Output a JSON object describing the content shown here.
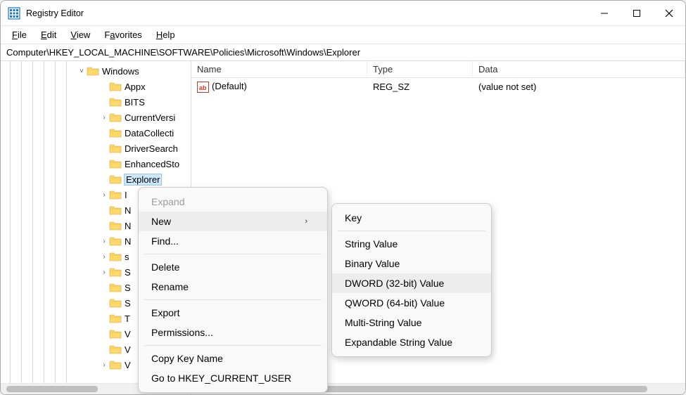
{
  "window": {
    "title": "Registry Editor"
  },
  "menubar": {
    "file": "File",
    "edit": "Edit",
    "view": "View",
    "favorites": "Favorites",
    "help": "Help"
  },
  "address": "Computer\\HKEY_LOCAL_MACHINE\\SOFTWARE\\Policies\\Microsoft\\Windows\\Explorer",
  "tree": {
    "root_indent": 108,
    "items": [
      {
        "label": "Windows",
        "expander": "˅",
        "indent": 108,
        "selected": false
      },
      {
        "label": "Appx",
        "expander": "",
        "indent": 140,
        "selected": false
      },
      {
        "label": "BITS",
        "expander": "",
        "indent": 140,
        "selected": false
      },
      {
        "label": "CurrentVersi",
        "expander": "›",
        "indent": 140,
        "selected": false
      },
      {
        "label": "DataCollecti",
        "expander": "",
        "indent": 140,
        "selected": false
      },
      {
        "label": "DriverSearch",
        "expander": "",
        "indent": 140,
        "selected": false
      },
      {
        "label": "EnhancedSto",
        "expander": "",
        "indent": 140,
        "selected": false
      },
      {
        "label": "Explorer",
        "expander": "",
        "indent": 140,
        "selected": true
      },
      {
        "label": "I",
        "expander": "›",
        "indent": 140,
        "selected": false
      },
      {
        "label": "N",
        "expander": "",
        "indent": 140,
        "selected": false
      },
      {
        "label": "N",
        "expander": "",
        "indent": 140,
        "selected": false
      },
      {
        "label": "N",
        "expander": "›",
        "indent": 140,
        "selected": false
      },
      {
        "label": "s",
        "expander": "›",
        "indent": 140,
        "selected": false
      },
      {
        "label": "S",
        "expander": "›",
        "indent": 140,
        "selected": false
      },
      {
        "label": "S",
        "expander": "",
        "indent": 140,
        "selected": false
      },
      {
        "label": "S",
        "expander": "",
        "indent": 140,
        "selected": false
      },
      {
        "label": "T",
        "expander": "",
        "indent": 140,
        "selected": false
      },
      {
        "label": "V",
        "expander": "",
        "indent": 140,
        "selected": false
      },
      {
        "label": "V",
        "expander": "",
        "indent": 140,
        "selected": false
      },
      {
        "label": "V",
        "expander": "›",
        "indent": 140,
        "selected": false
      }
    ]
  },
  "list": {
    "columns": {
      "name": "Name",
      "type": "Type",
      "data": "Data"
    },
    "rows": [
      {
        "name": "(Default)",
        "type": "REG_SZ",
        "data": "(value not set)",
        "icon": "string-value-icon"
      }
    ]
  },
  "context_menu": {
    "expand": "Expand",
    "new": "New",
    "find": "Find...",
    "delete": "Delete",
    "rename": "Rename",
    "export": "Export",
    "permissions": "Permissions...",
    "copy_key_name": "Copy Key Name",
    "go_to_hkcu": "Go to HKEY_CURRENT_USER"
  },
  "new_submenu": {
    "key": "Key",
    "string_value": "String Value",
    "binary_value": "Binary Value",
    "dword_value": "DWORD (32-bit) Value",
    "qword_value": "QWORD (64-bit) Value",
    "multi_string_value": "Multi-String Value",
    "expandable_string_value": "Expandable String Value"
  }
}
